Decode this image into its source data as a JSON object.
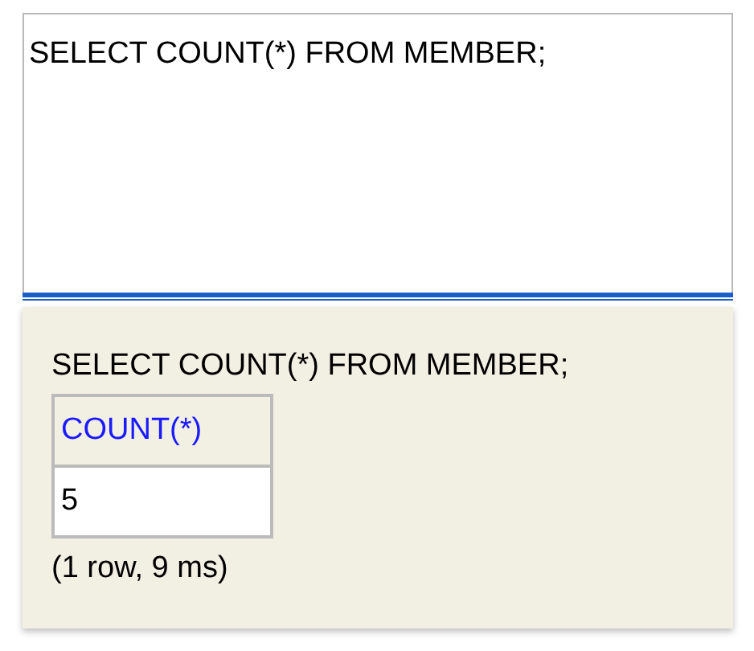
{
  "editor": {
    "value": "SELECT COUNT(*) FROM MEMBER;"
  },
  "result": {
    "statement": "SELECT COUNT(*) FROM MEMBER;",
    "table": {
      "columns": [
        "COUNT(*)"
      ],
      "rows": [
        [
          "5"
        ]
      ]
    },
    "summary": "(1 row, 9 ms)"
  }
}
